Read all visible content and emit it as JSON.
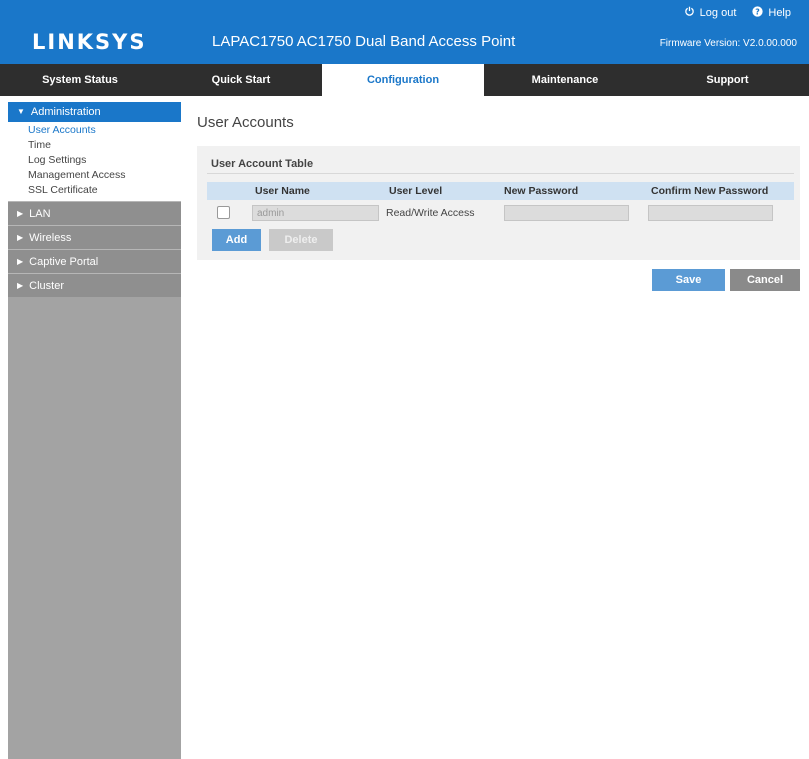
{
  "header": {
    "logo": "LINKSYS",
    "product_title": "LAPAC1750 AC1750 Dual Band Access Point",
    "logout_label": "Log out",
    "help_label": "Help",
    "firmware": "Firmware Version: V2.0.00.000"
  },
  "nav": {
    "tabs": [
      {
        "label": "System Status"
      },
      {
        "label": "Quick Start"
      },
      {
        "label": "Configuration",
        "active": true
      },
      {
        "label": "Maintenance"
      },
      {
        "label": "Support"
      }
    ]
  },
  "sidebar": {
    "administration": {
      "label": "Administration",
      "items": [
        "User Accounts",
        "Time",
        "Log Settings",
        "Management Access",
        "SSL Certificate"
      ]
    },
    "groups": [
      "LAN",
      "Wireless",
      "Captive Portal",
      "Cluster"
    ]
  },
  "main": {
    "page_title": "User Accounts",
    "table_title": "User Account Table",
    "columns": [
      "User Name",
      "User Level",
      "New Password",
      "Confirm New Password"
    ],
    "row": {
      "user_name": "admin",
      "user_level": "Read/Write Access",
      "new_password": "",
      "confirm_password": ""
    },
    "add_label": "Add",
    "delete_label": "Delete",
    "save_label": "Save",
    "cancel_label": "Cancel"
  },
  "colors": {
    "brand_blue": "#1a77c9",
    "nav_dark": "#2e2e2e",
    "sidebar_gray": "#a3a3a3",
    "button_blue": "#5b9bd5"
  }
}
